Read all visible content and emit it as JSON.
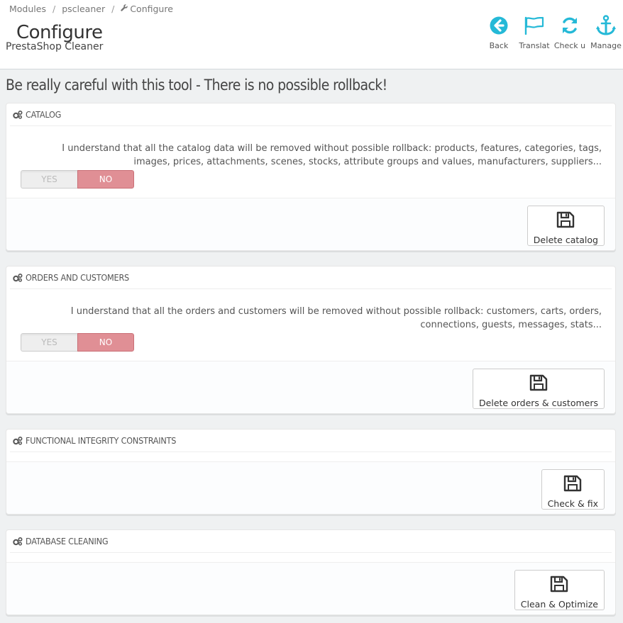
{
  "breadcrumb": {
    "items": [
      "Modules",
      "pscleaner",
      "Configure"
    ]
  },
  "header": {
    "title": "Configure",
    "subtitle": "PrestaShop Cleaner"
  },
  "toolbar": {
    "back_label": "Back",
    "translate_label": "Translat",
    "check_label": "Check u",
    "manage_label": "Manage",
    "icon_color": "#25b9d7"
  },
  "warning": "Be really careful with this tool - There is no possible rollback!",
  "panels": [
    {
      "heading": "CATALOG",
      "description": "I understand that all the catalog data will be removed without possible rollback: products, features, categories, tags, images, prices, attachments, scenes, stocks, attribute groups and values, manufacturers, suppliers...",
      "switch_yes": "YES",
      "switch_no": "NO",
      "selected": "NO",
      "button_label": "Delete catalog"
    },
    {
      "heading": "ORDERS AND CUSTOMERS",
      "description": "I understand that all the orders and customers will be removed without possible rollback: customers, carts, orders, connections, guests, messages, stats...",
      "switch_yes": "YES",
      "switch_no": "NO",
      "selected": "NO",
      "button_label": "Delete orders & customers"
    },
    {
      "heading": "FUNCTIONAL INTEGRITY CONSTRAINTS",
      "button_label": "Check & fix"
    },
    {
      "heading": "DATABASE CLEANING",
      "button_label": "Clean & Optimize"
    }
  ],
  "colors": {
    "switch_no_bg": "#e08f95",
    "accent": "#25b9d7"
  }
}
